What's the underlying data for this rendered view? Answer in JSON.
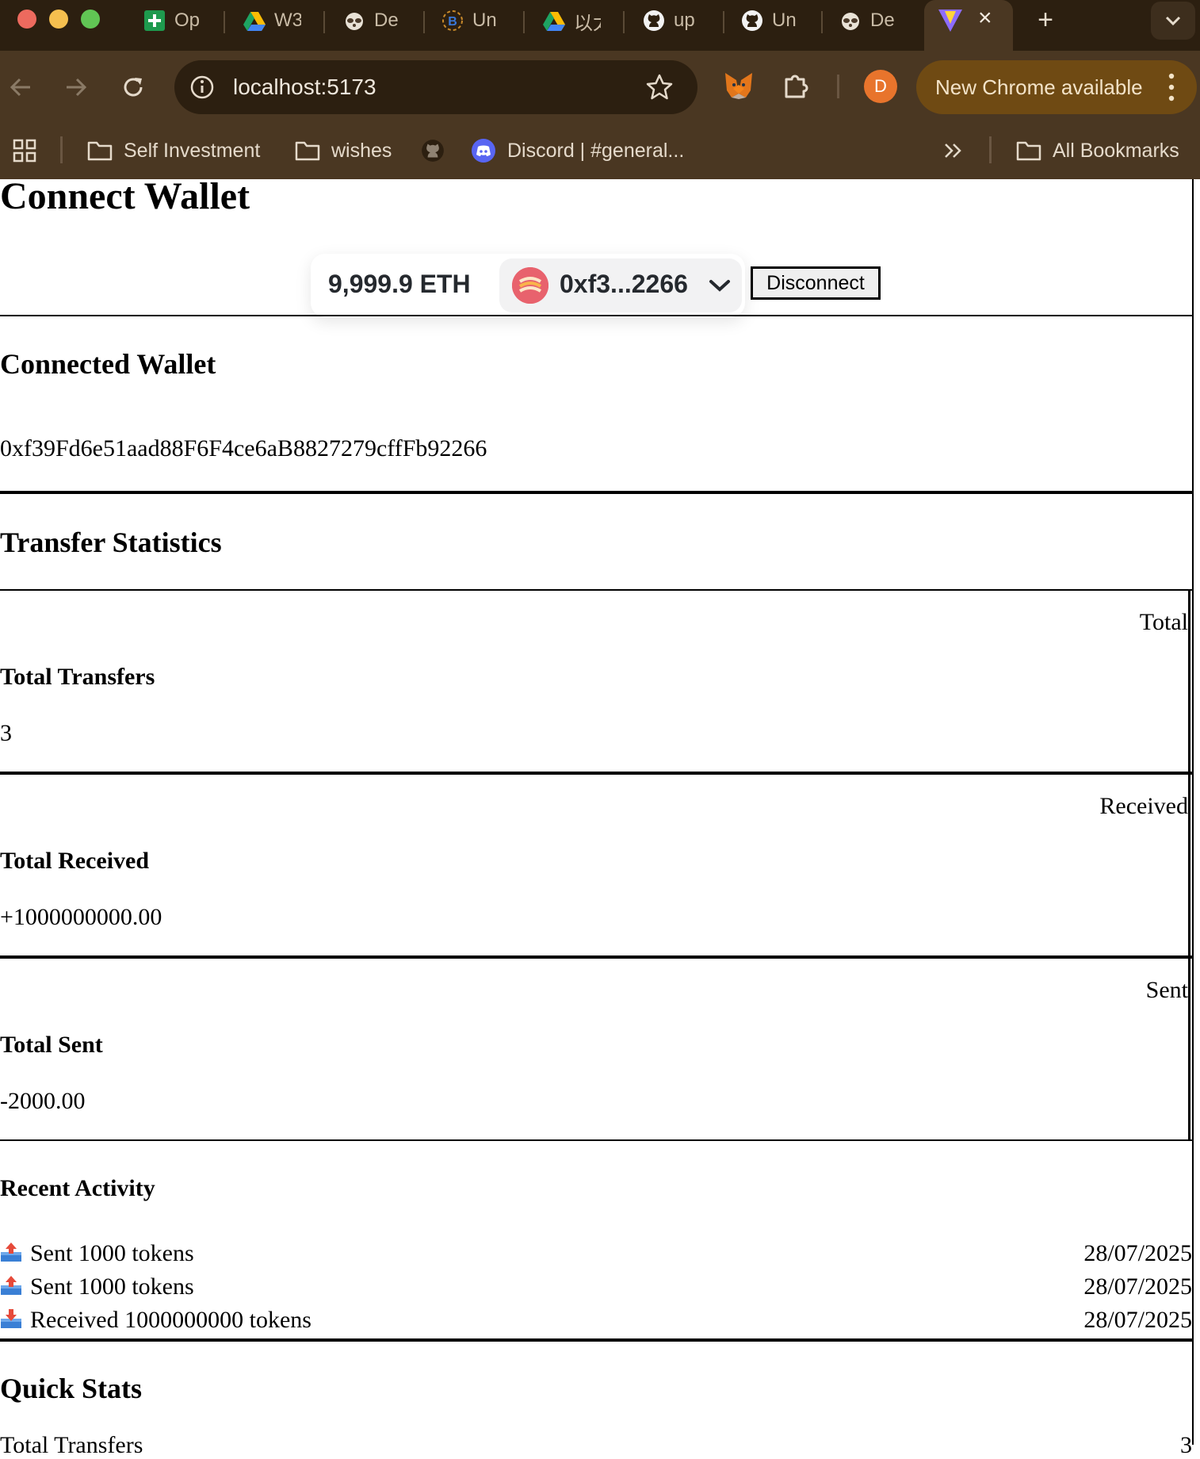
{
  "browser": {
    "tabs": [
      {
        "icon": "google-sheets-icon",
        "label": "Op"
      },
      {
        "icon": "google-drive-icon",
        "label": "W3"
      },
      {
        "icon": "raccoon-icon",
        "label": "De"
      },
      {
        "icon": "blockchain-icon",
        "label": "Un"
      },
      {
        "icon": "google-drive-icon",
        "label": "以太"
      },
      {
        "icon": "github-icon",
        "label": "up"
      },
      {
        "icon": "github-icon",
        "label": "Un"
      },
      {
        "icon": "raccoon-icon",
        "label": "De"
      }
    ],
    "active_tab": {
      "icon": "vite-icon",
      "close": "×"
    },
    "new_tab": "+",
    "url": "localhost:5173",
    "avatar_initial": "D",
    "update_label": "New Chrome available",
    "bookmarks": [
      {
        "icon": "folder-icon",
        "label": "Self Investment"
      },
      {
        "icon": "folder-icon",
        "label": "wishes"
      },
      {
        "icon": "github-icon",
        "label": ""
      },
      {
        "icon": "discord-icon",
        "label": "Discord | #general..."
      }
    ],
    "all_bookmarks": "All Bookmarks",
    "colors": {
      "tabstrip": "#2c1f10",
      "toolbar": "#4a3722",
      "update_pill": "#6f4a13"
    }
  },
  "page": {
    "title": "Connect Wallet",
    "wallet": {
      "balance": "9,999.9 ETH",
      "short_address": "0xf3...2266",
      "disconnect_label": "Disconnect"
    },
    "connected": {
      "heading": "Connected Wallet",
      "address": "0xf39Fd6e51aad88F6F4ce6aB8827279cffFb92266"
    },
    "stats": {
      "heading": "Transfer Statistics",
      "cards": [
        {
          "tag": "Total",
          "label": "Total Transfers",
          "value": "3"
        },
        {
          "tag": "Received",
          "label": "Total Received",
          "value": "+1000000000.00"
        },
        {
          "tag": "Sent",
          "label": "Total Sent",
          "value": "-2000.00"
        }
      ]
    },
    "activity": {
      "heading": "Recent Activity",
      "items": [
        {
          "icon": "outbox-tray-icon",
          "text": "Sent 1000 tokens",
          "date": "28/07/2025"
        },
        {
          "icon": "outbox-tray-icon",
          "text": "Sent 1000 tokens",
          "date": "28/07/2025"
        },
        {
          "icon": "inbox-tray-icon",
          "text": "Received 1000000000 tokens",
          "date": "28/07/2025"
        }
      ]
    },
    "quick_stats": {
      "heading": "Quick Stats",
      "first_row_label": "Total Transfers",
      "first_row_value": "3"
    }
  }
}
